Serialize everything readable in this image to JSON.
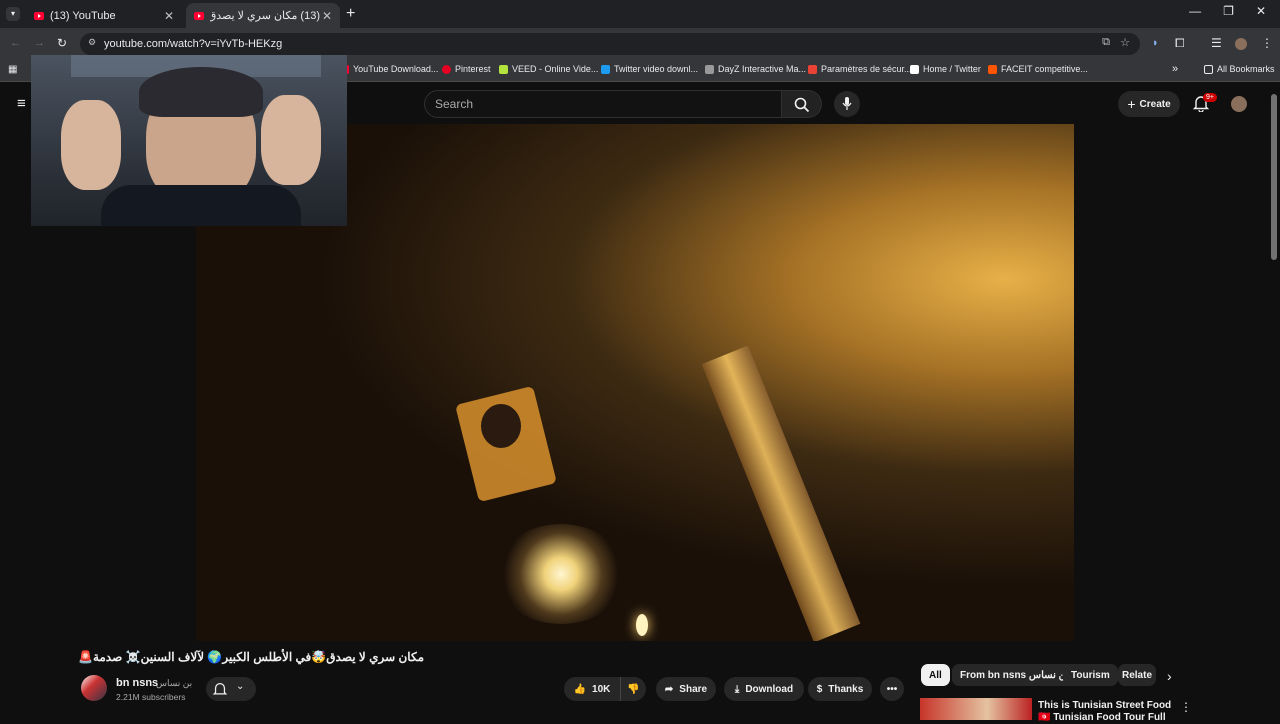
{
  "browser": {
    "tabs": [
      {
        "label": "(13) YouTube"
      },
      {
        "label": "(13) مكان سري لا يصدق🤯 ف..."
      }
    ],
    "new_tab": "+",
    "window_controls": [
      "—",
      "❐",
      "✕"
    ],
    "url": "youtube.com/watch?v=iYvTb-HEKzg",
    "bookmarks": [
      {
        "label": "YouTube Download...",
        "color": "#ff0033"
      },
      {
        "label": "Pinterest",
        "color": "#e60023"
      },
      {
        "label": "VEED - Online Vide...",
        "color": "#b4e33d"
      },
      {
        "label": "Twitter video downl...",
        "color": "#1d9bf0"
      },
      {
        "label": "DayZ Interactive Ma...",
        "color": "#999999"
      },
      {
        "label": "Paramètres de sécur...",
        "color": "#ea4335"
      },
      {
        "label": "Home / Twitter",
        "color": "#ffffff"
      },
      {
        "label": "FACEIT competitive...",
        "color": "#ff5500"
      }
    ],
    "bookmarks_overflow": "»",
    "all_bookmarks": "All Bookmarks"
  },
  "youtube": {
    "search_placeholder": "Search",
    "create_label": "Create",
    "notifications_badge": "9+",
    "video": {
      "title": "مكان سري لا يصدق🤯في الأطلس الكبير🌍 لآلاف السنين☠️ صدمة🚨",
      "channel": "bn nsns",
      "channel_alt": "بن نساس",
      "subscribers": "2.21M subscribers",
      "likes": "10K",
      "share": "Share",
      "download": "Download",
      "thanks": "Thanks",
      "more": "•••"
    },
    "chips": [
      "All",
      "From bn nsns بن نساس",
      "Tourism",
      "Relate"
    ],
    "recommendation": {
      "title": "This is Tunisian Street Food 🇹🇳 Tunisian Food Tour Full",
      "more": "⋮"
    }
  }
}
